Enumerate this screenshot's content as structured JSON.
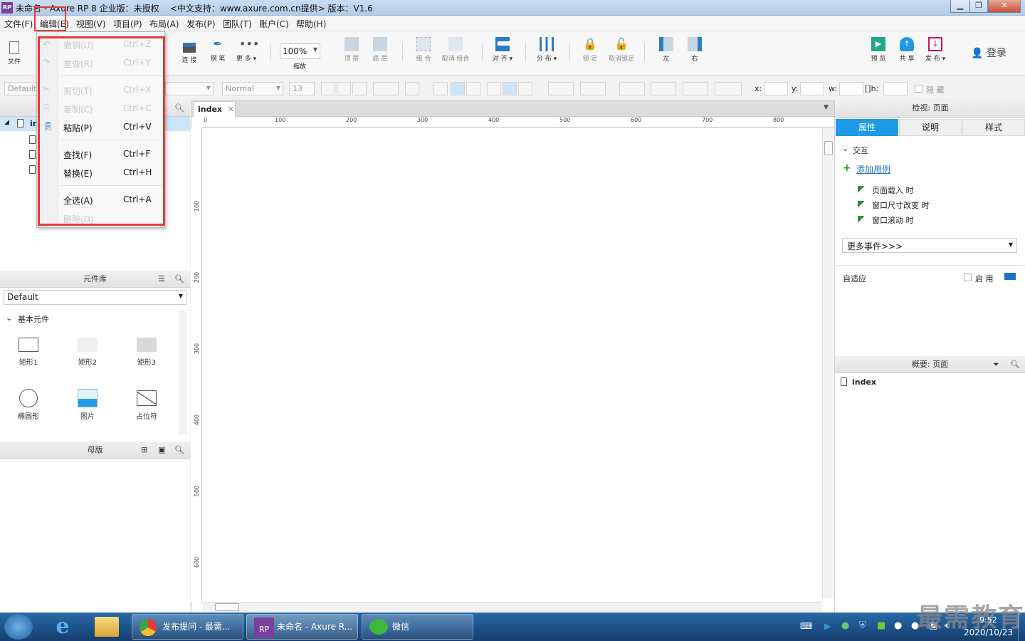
{
  "window": {
    "title": "未命名 - Axure RP 8 企业版：未授权    <中文支持：www.axure.com.cn提供> 版本：V1.6",
    "logo": "RP"
  },
  "menubar": [
    "文件(F)",
    "编辑(E)",
    "视图(V)",
    "项目(P)",
    "布局(A)",
    "发布(P)",
    "团队(T)",
    "账户(C)",
    "帮助(H)"
  ],
  "toolbar": {
    "file": "文件",
    "connect": "连 接",
    "pen": "钢 笔",
    "more": "更 多 ▾",
    "zoom": "100%",
    "zoom_label": "缩放",
    "top": "顶 层",
    "bottom": "底 层",
    "group": "组 合",
    "ungroup": "取消 组合",
    "align": "对 齐 ▾",
    "distribute": "分 布 ▾",
    "lock": "锁 定",
    "unlock": "取消锁定",
    "left": "左",
    "right": "右",
    "preview": "预 览",
    "share": "共 享",
    "publish": "发 布 ▾",
    "login": "登录"
  },
  "formatbar": {
    "style": "Default",
    "font_style": "Normal",
    "font_size": "13",
    "x": "x:",
    "y": "y:",
    "w": "w:",
    "h": "h:",
    "hide": "隐 藏"
  },
  "pages": {
    "root": "in"
  },
  "library": {
    "title": "元件库",
    "selected": "Default",
    "section": "基本元件",
    "items": [
      "矩形1",
      "矩形2",
      "矩形3",
      "椭圆形",
      "图片",
      "占位符"
    ]
  },
  "masters": {
    "title": "母版"
  },
  "canvas": {
    "tab": "index",
    "ruler_h": [
      "0",
      "100",
      "200",
      "300",
      "400",
      "500",
      "600",
      "700",
      "800"
    ],
    "ruler_v": [
      "100",
      "200",
      "300",
      "400",
      "500",
      "600"
    ]
  },
  "inspector": {
    "title": "检视: 页面",
    "tabs": [
      "属性",
      "说明",
      "样式"
    ],
    "interaction": "交互",
    "add_case": "添加用例",
    "events": [
      "页面载入 时",
      "窗口尺寸改变 时",
      "窗口滚动 时"
    ],
    "more_events": "更多事件>>>",
    "adaptive": "自适应",
    "enable": "启 用"
  },
  "outline": {
    "title": "概要: 页面",
    "item": "index"
  },
  "edit_menu": [
    {
      "label": "撤销(U)",
      "shortcut": "Ctrl+Z",
      "enabled": false
    },
    {
      "label": "重做(R)",
      "shortcut": "Ctrl+Y",
      "enabled": false
    },
    {
      "label": "剪切(T)",
      "shortcut": "Ctrl+X",
      "enabled": false
    },
    {
      "label": "复制(C)",
      "shortcut": "Ctrl+C",
      "enabled": false
    },
    {
      "label": "粘贴(P)",
      "shortcut": "Ctrl+V",
      "enabled": true
    },
    {
      "label": "查找(F)",
      "shortcut": "Ctrl+F",
      "enabled": true
    },
    {
      "label": "替换(E)",
      "shortcut": "Ctrl+H",
      "enabled": true
    },
    {
      "label": "全选(A)",
      "shortcut": "Ctrl+A",
      "enabled": true
    },
    {
      "label": "删除(D)",
      "shortcut": "",
      "enabled": false
    }
  ],
  "taskbar": {
    "tasks": [
      "发布提问 - 最需...",
      "未命名 - Axure R...",
      "微信"
    ],
    "time": "9:52",
    "date": "2020/10/23"
  },
  "watermark": "最需教育"
}
